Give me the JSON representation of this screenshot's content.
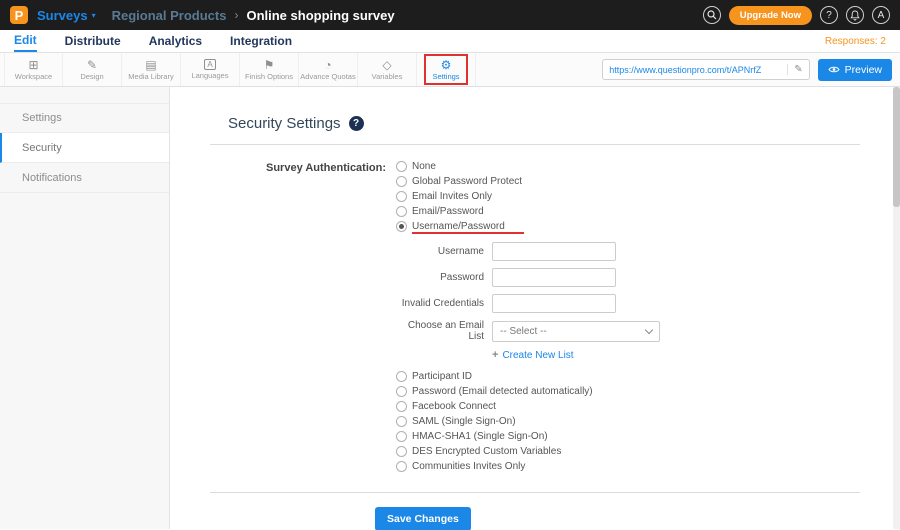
{
  "topbar": {
    "logo": "P",
    "product": "Surveys",
    "menu_caret": "▾",
    "breadcrumb_parent": "Regional Products",
    "breadcrumb_separator": "›",
    "breadcrumb_current": "Online shopping survey",
    "upgrade_label": "Upgrade Now",
    "help_label": "?",
    "avatar_label": "A"
  },
  "nav": {
    "tabs": [
      {
        "label": "Edit",
        "active": true
      },
      {
        "label": "Distribute",
        "active": false
      },
      {
        "label": "Analytics",
        "active": false
      },
      {
        "label": "Integration",
        "active": false
      }
    ],
    "responses_label": "Responses: 2"
  },
  "toolbar": {
    "items": [
      {
        "label": "Workspace",
        "icon": "workspace-icon",
        "glyph": "⊞"
      },
      {
        "label": "Design",
        "icon": "design-icon",
        "glyph": "✎"
      },
      {
        "label": "Media Library",
        "icon": "media-library-icon",
        "glyph": "▤"
      },
      {
        "label": "Languages",
        "icon": "languages-icon",
        "glyph": "A"
      },
      {
        "label": "Finish Options",
        "icon": "finish-options-icon",
        "glyph": "⚑"
      },
      {
        "label": "Advance Quotas",
        "icon": "advance-quotas-icon",
        "glyph": "◔"
      },
      {
        "label": "Variables",
        "icon": "variables-icon",
        "glyph": "◇"
      },
      {
        "label": "Settings",
        "icon": "settings-icon",
        "glyph": "⚙"
      }
    ],
    "url_value": "https://www.questionpro.com/t/APNrfZ",
    "pencil_glyph": "✎",
    "preview_label": "Preview"
  },
  "sidebar": {
    "items": [
      {
        "label": "Settings",
        "active": false
      },
      {
        "label": "Security",
        "active": true
      },
      {
        "label": "Notifications",
        "active": false
      }
    ]
  },
  "main": {
    "title": "Security Settings",
    "help_label": "?",
    "auth_label": "Survey Authentication:",
    "radio_group_top": [
      {
        "label": "None",
        "selected": false
      },
      {
        "label": "Global Password Protect",
        "selected": false
      },
      {
        "label": "Email Invites Only",
        "selected": false
      },
      {
        "label": "Email/Password",
        "selected": false
      },
      {
        "label": "Username/Password",
        "selected": true
      }
    ],
    "fields": [
      {
        "label": "Username",
        "value": ""
      },
      {
        "label": "Password",
        "value": ""
      },
      {
        "label": "Invalid Credentials",
        "value": ""
      }
    ],
    "email_list_label": "Choose an Email List",
    "email_list_value": "-- Select --",
    "create_list_plus": "+",
    "create_list_label": "Create New List",
    "radio_group_bottom": [
      {
        "label": "Participant ID"
      },
      {
        "label": "Password (Email detected automatically)"
      },
      {
        "label": "Facebook Connect"
      },
      {
        "label": "SAML (Single Sign-On)"
      },
      {
        "label": "HMAC-SHA1 (Single Sign-On)"
      },
      {
        "label": "DES Encrypted Custom Variables"
      },
      {
        "label": "Communities Invites Only"
      }
    ],
    "save_label": "Save Changes"
  },
  "colors": {
    "accent_blue": "#1b87e6",
    "orange": "#f7941e",
    "topbar_bg": "#1d1d1d",
    "annotation_red": "#e03131"
  }
}
